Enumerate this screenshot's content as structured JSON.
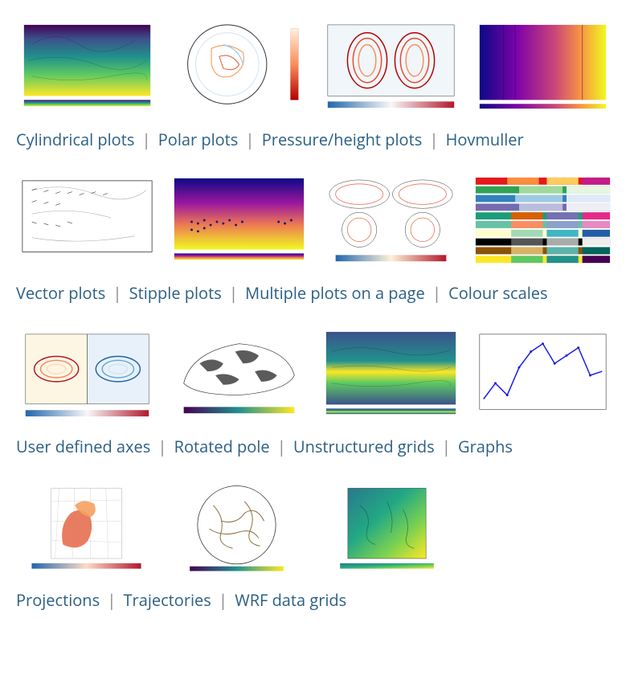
{
  "rows": [
    {
      "links": [
        {
          "label": "Cylindrical plots"
        },
        {
          "label": "Polar plots"
        },
        {
          "label": "Pressure/height plots"
        },
        {
          "label": "Hovmuller"
        }
      ]
    },
    {
      "links": [
        {
          "label": "Vector plots"
        },
        {
          "label": "Stipple plots"
        },
        {
          "label": "Multiple plots on a page"
        },
        {
          "label": "Colour scales"
        }
      ]
    },
    {
      "links": [
        {
          "label": "User defined axes"
        },
        {
          "label": "Rotated pole"
        },
        {
          "label": "Unstructured grids"
        },
        {
          "label": "Graphs"
        }
      ]
    },
    {
      "links": [
        {
          "label": "Projections"
        },
        {
          "label": "Trajectories"
        },
        {
          "label": "WRF data grids"
        }
      ]
    }
  ],
  "separator": "|"
}
